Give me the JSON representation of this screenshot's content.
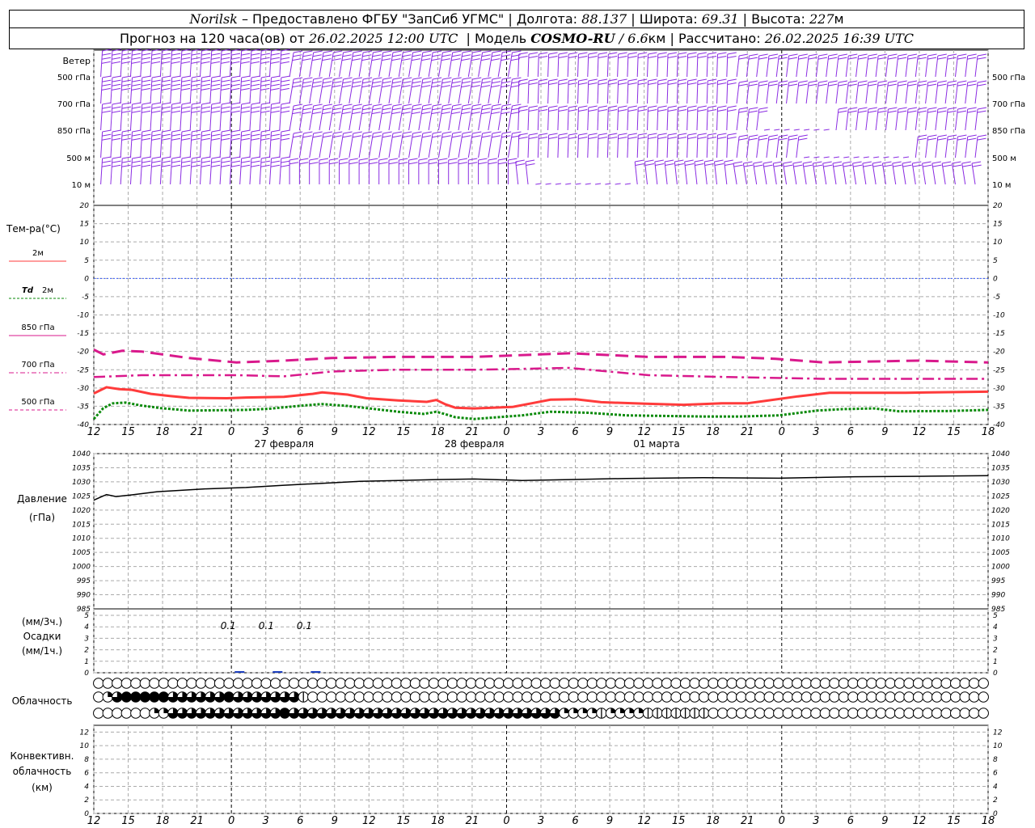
{
  "header": {
    "station": "Norilsk",
    "provider": "– Предоставлено ФГБУ \"ЗапСиб УГМС\"",
    "lon_label": "Долгота:",
    "lon_value": "88.137",
    "lat_label": "Широта:",
    "lat_value": "69.31",
    "alt_label": "Высота:",
    "alt_value": "227",
    "alt_unit": "м",
    "forecast_label": "Прогноз на 120 часа(ов) от",
    "forecast_start": "26.02.2025 12:00 UTC",
    "model_label": "Модель",
    "model_name": "COSMO-RU",
    "model_res": "/ 6.6",
    "model_res_unit": "км",
    "calc_label": "Рассчитано:",
    "calc_time": "26.02.2025 16:39 UTC"
  },
  "colors": {
    "wind": "#8a2be2",
    "t2m": "#ff3b3b",
    "td2m": "#0a8a0a",
    "t850": "#d9198c",
    "t700": "#d9198c",
    "t500": "#d9198c",
    "zero_line": "#3a5fff",
    "pressure": "#000000",
    "precip": "#1c3fc0",
    "grid": "#aaaaaa"
  },
  "chart_data": {
    "type": "line",
    "x_hours": [
      12,
      15,
      18,
      21,
      0,
      3,
      6,
      9,
      12,
      15,
      18,
      21,
      0,
      3,
      6,
      9,
      12,
      15,
      18,
      21,
      0,
      3,
      6,
      9,
      12,
      15,
      18
    ],
    "date_labels": [
      "27 февраля",
      "28 февраля",
      "01 марта"
    ],
    "wind": {
      "title": "Ветер",
      "levels": [
        "500 гПа",
        "700 гПа",
        "850 гПа",
        "500 м",
        "10  м"
      ]
    },
    "temperature": {
      "title": "Тем-ра(°C)",
      "ylim": [
        -40,
        20
      ],
      "yticks": [
        20,
        15,
        10,
        5,
        0,
        -5,
        -10,
        -15,
        -20,
        -25,
        -30,
        -35,
        -40
      ],
      "legend": [
        {
          "label": "2м"
        },
        {
          "label": "Td 2м"
        },
        {
          "label": "850 гПа"
        },
        {
          "label": "700 гПа"
        },
        {
          "label": "500 гПа"
        }
      ],
      "series": [
        {
          "key": "t850",
          "points": [
            [
              0,
              -19.5
            ],
            [
              3,
              -20.8
            ],
            [
              9,
              -19.8
            ],
            [
              15,
              -20
            ],
            [
              30,
              -21.8
            ],
            [
              45,
              -23
            ],
            [
              60,
              -22.5
            ],
            [
              75,
              -21.8
            ],
            [
              95,
              -21.5
            ],
            [
              120,
              -21.5
            ],
            [
              150,
              -20.5
            ],
            [
              175,
              -21.5
            ],
            [
              200,
              -21.5
            ],
            [
              215,
              -22
            ],
            [
              230,
              -23
            ],
            [
              260,
              -22.5
            ],
            [
              282,
              -23
            ]
          ]
        },
        {
          "key": "t700",
          "points": [
            [
              0,
              -27
            ],
            [
              15,
              -26.5
            ],
            [
              45,
              -26.5
            ],
            [
              60,
              -26.8
            ],
            [
              75,
              -25.5
            ],
            [
              95,
              -25
            ],
            [
              120,
              -25
            ],
            [
              150,
              -24.5
            ],
            [
              175,
              -26.5
            ],
            [
              200,
              -27
            ],
            [
              230,
              -27.5
            ],
            [
              260,
              -27.5
            ],
            [
              282,
              -27.5
            ]
          ]
        },
        {
          "key": "t2m",
          "points": [
            [
              0,
              -31.5
            ],
            [
              4,
              -29.8
            ],
            [
              8,
              -30.3
            ],
            [
              12,
              -30.5
            ],
            [
              18,
              -31.6
            ],
            [
              24,
              -32.2
            ],
            [
              30,
              -32.7
            ],
            [
              42,
              -32.8
            ],
            [
              48,
              -32.6
            ],
            [
              60,
              -32.4
            ],
            [
              69,
              -31.6
            ],
            [
              72,
              -31.2
            ],
            [
              80,
              -31.8
            ],
            [
              86,
              -32.8
            ],
            [
              96,
              -33.4
            ],
            [
              105,
              -33.8
            ],
            [
              108,
              -33.3
            ],
            [
              111,
              -34.5
            ],
            [
              114,
              -35.4
            ],
            [
              120,
              -35.6
            ],
            [
              132,
              -35.2
            ],
            [
              138,
              -34.2
            ],
            [
              144,
              -33.2
            ],
            [
              152,
              -33.1
            ],
            [
              160,
              -33.9
            ],
            [
              174,
              -34.3
            ],
            [
              186,
              -34.6
            ],
            [
              198,
              -34.2
            ],
            [
              206,
              -34.2
            ],
            [
              212,
              -33.5
            ],
            [
              222,
              -32.3
            ],
            [
              232,
              -31.3
            ],
            [
              256,
              -31.3
            ],
            [
              282,
              -31
            ]
          ]
        },
        {
          "key": "td2m",
          "points": [
            [
              0,
              -38.5
            ],
            [
              3,
              -35.5
            ],
            [
              6,
              -34.2
            ],
            [
              10,
              -34
            ],
            [
              15,
              -34.8
            ],
            [
              21,
              -35.5
            ],
            [
              30,
              -36.2
            ],
            [
              48,
              -36
            ],
            [
              55,
              -35.7
            ],
            [
              66,
              -34.8
            ],
            [
              72,
              -34.4
            ],
            [
              80,
              -34.9
            ],
            [
              96,
              -36.5
            ],
            [
              104,
              -37.1
            ],
            [
              108,
              -36.5
            ],
            [
              111,
              -37.2
            ],
            [
              114,
              -38
            ],
            [
              120,
              -38.5
            ],
            [
              135,
              -37.5
            ],
            [
              144,
              -36.5
            ],
            [
              156,
              -36.8
            ],
            [
              168,
              -37.5
            ],
            [
              192,
              -37.8
            ],
            [
              204,
              -37.8
            ],
            [
              216,
              -37.5
            ],
            [
              228,
              -36.2
            ],
            [
              236,
              -35.8
            ],
            [
              246,
              -35.6
            ],
            [
              254,
              -36.4
            ],
            [
              270,
              -36.3
            ],
            [
              282,
              -36
            ]
          ]
        }
      ]
    },
    "pressure": {
      "title": "Давление",
      "unit": "(гПа)",
      "ylim": [
        985,
        1040
      ],
      "yticks": [
        1040,
        1035,
        1030,
        1025,
        1020,
        1015,
        1010,
        1005,
        1000,
        995,
        990,
        985
      ],
      "points": [
        [
          0,
          1023.5
        ],
        [
          2,
          1024.5
        ],
        [
          4,
          1025.5
        ],
        [
          7,
          1024.8
        ],
        [
          12,
          1025.4
        ],
        [
          20,
          1026.5
        ],
        [
          35,
          1027.5
        ],
        [
          48,
          1028
        ],
        [
          60,
          1028.8
        ],
        [
          72,
          1029.5
        ],
        [
          84,
          1030.2
        ],
        [
          96,
          1030.5
        ],
        [
          108,
          1030.8
        ],
        [
          120,
          1031
        ],
        [
          135,
          1030.5
        ],
        [
          150,
          1030.8
        ],
        [
          168,
          1031.2
        ],
        [
          192,
          1031.5
        ],
        [
          216,
          1031.3
        ],
        [
          240,
          1031.8
        ],
        [
          264,
          1032
        ],
        [
          282,
          1032.2
        ]
      ]
    },
    "precip": {
      "unit_3h": "(мм/3ч.)",
      "title": "Осадки",
      "unit_1h": "(мм/1ч.)",
      "ylim": [
        0,
        5
      ],
      "yticks": [
        5,
        4,
        3,
        2,
        1,
        0
      ],
      "labels": [
        {
          "x": 48,
          "text": "0.1"
        },
        {
          "x": 60,
          "text": "0.1"
        },
        {
          "x": 72,
          "text": "0.1"
        }
      ]
    },
    "clouds": {
      "title": "Облачность",
      "rows": [
        [
          0,
          0,
          0,
          0,
          0,
          0,
          0,
          0,
          0,
          0,
          0,
          0,
          0,
          0,
          0,
          0,
          0,
          0,
          0,
          0,
          0,
          0,
          0,
          0,
          0,
          0,
          0,
          0,
          0,
          0,
          0,
          0,
          0,
          0,
          0,
          0,
          0,
          0,
          0,
          0,
          0,
          0,
          0,
          0,
          0,
          0,
          0,
          0,
          0,
          0,
          0,
          0,
          0,
          0,
          0,
          0,
          0,
          0,
          0,
          0,
          0,
          0,
          0,
          0,
          0,
          0,
          0,
          0,
          0,
          0,
          0,
          0,
          0,
          0,
          0,
          0,
          0,
          0,
          0,
          0,
          0,
          0,
          0,
          0,
          0,
          0,
          0,
          0,
          0,
          0,
          0,
          0,
          0,
          0,
          0,
          0
        ],
        [
          0,
          2,
          3,
          4,
          4,
          4,
          4,
          4,
          3,
          3,
          3,
          3,
          3,
          3,
          4,
          3,
          3,
          3,
          3,
          3,
          3,
          3,
          1,
          0,
          0,
          0,
          0,
          0,
          0,
          0,
          0,
          0,
          0,
          0,
          0,
          0,
          0,
          0,
          0,
          0,
          0,
          0,
          0,
          0,
          0,
          0,
          0,
          0,
          0,
          0,
          0,
          0,
          0,
          0,
          0,
          0,
          0,
          0,
          0,
          0,
          0,
          0,
          0,
          0,
          0,
          0,
          0,
          0,
          0,
          0,
          0,
          0,
          0,
          0,
          0,
          0,
          0,
          0,
          0,
          0,
          0,
          0,
          0,
          0,
          0,
          0,
          0,
          0,
          0,
          0,
          0,
          0,
          0,
          0,
          0,
          0
        ],
        [
          0,
          0,
          0,
          0,
          0,
          0,
          2,
          2,
          3,
          3,
          3,
          3,
          3,
          3,
          3,
          3,
          3,
          3,
          3,
          3,
          4,
          3,
          3,
          3,
          3,
          3,
          3,
          3,
          3,
          3,
          3,
          3,
          3,
          3,
          3,
          3,
          3,
          3,
          3,
          3,
          3,
          3,
          3,
          3,
          3,
          3,
          3,
          3,
          3,
          3,
          2,
          2,
          2,
          2,
          1,
          2,
          2,
          2,
          2,
          1,
          1,
          1,
          1,
          1,
          1,
          1,
          0,
          0,
          0,
          0,
          0,
          0,
          0,
          0,
          0,
          0,
          0,
          0,
          0,
          0,
          0,
          0,
          0,
          0,
          0,
          0,
          0,
          0,
          0,
          0,
          0,
          0,
          0,
          0,
          0,
          0
        ]
      ]
    },
    "convective": {
      "title1": "Конвективн.",
      "title2": "облачность",
      "unit": "(км)",
      "ylim": [
        0,
        13
      ],
      "yticks": [
        12,
        10,
        8,
        6,
        4,
        2,
        0
      ]
    }
  }
}
